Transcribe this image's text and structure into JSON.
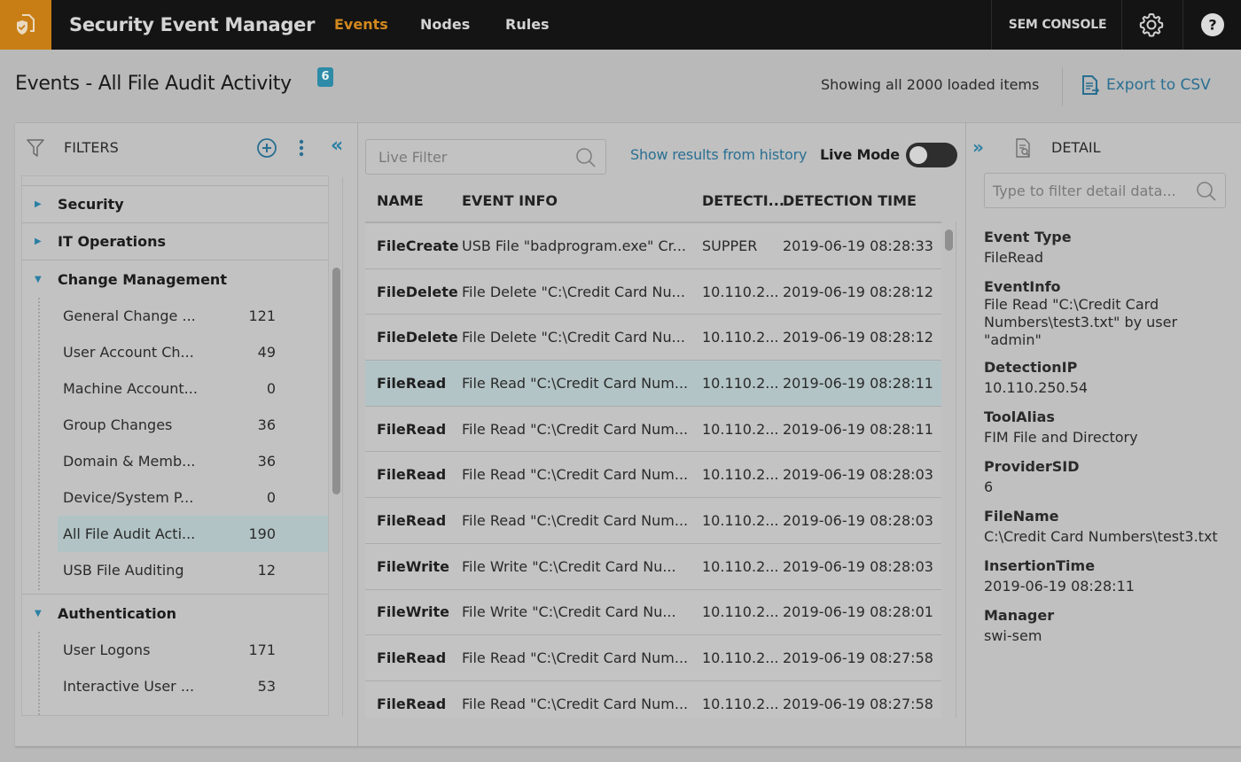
{
  "app": {
    "title": "Security Event Manager",
    "brand_color": "#c97e15",
    "nav": [
      {
        "label": "Events",
        "active": true
      },
      {
        "label": "Nodes",
        "active": false
      },
      {
        "label": "Rules",
        "active": false
      }
    ],
    "console_label": "SEM CONSOLE",
    "icons": {
      "logo": "shield-document-icon",
      "settings": "gear-icon",
      "help": "question-circle-icon"
    }
  },
  "page": {
    "title": "Events - All File Audit Activity",
    "badge": "6",
    "showing": "Showing all 2000 loaded items",
    "export_label": "Export to CSV"
  },
  "filters": {
    "label": "FILTERS",
    "groups": [
      {
        "label": "Security",
        "expanded": false,
        "children": []
      },
      {
        "label": "IT Operations",
        "expanded": false,
        "children": []
      },
      {
        "label": "Change Management",
        "expanded": true,
        "children": [
          {
            "label": "General Change ...",
            "count": "121",
            "selected": false
          },
          {
            "label": "User Account Ch...",
            "count": "49",
            "selected": false
          },
          {
            "label": "Machine Account...",
            "count": "0",
            "selected": false
          },
          {
            "label": "Group Changes",
            "count": "36",
            "selected": false
          },
          {
            "label": "Domain & Memb...",
            "count": "36",
            "selected": false
          },
          {
            "label": "Device/System P...",
            "count": "0",
            "selected": false
          },
          {
            "label": "All File Audit Acti...",
            "count": "190",
            "selected": true
          },
          {
            "label": "USB File Auditing",
            "count": "12",
            "selected": false
          }
        ]
      },
      {
        "label": "Authentication",
        "expanded": true,
        "children": [
          {
            "label": "User Logons",
            "count": "171",
            "selected": false
          },
          {
            "label": "Interactive User ...",
            "count": "53",
            "selected": false
          }
        ]
      }
    ]
  },
  "events": {
    "live_filter_placeholder": "Live Filter",
    "history_link": "Show results from history",
    "live_mode_label": "Live Mode",
    "live_mode_on": false,
    "columns": [
      "NAME",
      "EVENT INFO",
      "DETECTI...",
      "DETECTION TIME"
    ],
    "rows": [
      {
        "name": "FileCreate",
        "info": "USB File \"badprogram.exe\" Cr...",
        "ip": "SUPPER",
        "time": "2019-06-19 08:28:33",
        "selected": false
      },
      {
        "name": "FileDelete",
        "info": "File Delete \"C:\\Credit Card Nu...",
        "ip": "10.110.2...",
        "time": "2019-06-19 08:28:12",
        "selected": false
      },
      {
        "name": "FileDelete",
        "info": "File Delete \"C:\\Credit Card Nu...",
        "ip": "10.110.2...",
        "time": "2019-06-19 08:28:12",
        "selected": false
      },
      {
        "name": "FileRead",
        "info": "File Read \"C:\\Credit Card Num...",
        "ip": "10.110.2...",
        "time": "2019-06-19 08:28:11",
        "selected": true
      },
      {
        "name": "FileRead",
        "info": "File Read \"C:\\Credit Card Num...",
        "ip": "10.110.2...",
        "time": "2019-06-19 08:28:11",
        "selected": false
      },
      {
        "name": "FileRead",
        "info": "File Read \"C:\\Credit Card Num...",
        "ip": "10.110.2...",
        "time": "2019-06-19 08:28:03",
        "selected": false
      },
      {
        "name": "FileRead",
        "info": "File Read \"C:\\Credit Card Num...",
        "ip": "10.110.2...",
        "time": "2019-06-19 08:28:03",
        "selected": false
      },
      {
        "name": "FileWrite",
        "info": "File Write \"C:\\Credit Card Nu...",
        "ip": "10.110.2...",
        "time": "2019-06-19 08:28:03",
        "selected": false
      },
      {
        "name": "FileWrite",
        "info": "File Write \"C:\\Credit Card Nu...",
        "ip": "10.110.2...",
        "time": "2019-06-19 08:28:01",
        "selected": false
      },
      {
        "name": "FileRead",
        "info": "File Read \"C:\\Credit Card Num...",
        "ip": "10.110.2...",
        "time": "2019-06-19 08:27:58",
        "selected": false
      },
      {
        "name": "FileRead",
        "info": "File Read \"C:\\Credit Card Num...",
        "ip": "10.110.2...",
        "time": "2019-06-19 08:27:58",
        "selected": false
      }
    ]
  },
  "detail": {
    "title": "DETAIL",
    "filter_placeholder": "Type to filter detail data...",
    "fields": [
      {
        "key": "Event Type",
        "value": "FileRead"
      },
      {
        "key": "EventInfo",
        "value": "File Read \"C:\\Credit Card\nNumbers\\test3.txt\" by user \"admin\""
      },
      {
        "key": "DetectionIP",
        "value": "10.110.250.54"
      },
      {
        "key": "ToolAlias",
        "value": "FIM File and Directory"
      },
      {
        "key": "ProviderSID",
        "value": "6"
      },
      {
        "key": "FileName",
        "value": "C:\\Credit Card Numbers\\test3.txt"
      },
      {
        "key": "InsertionTime",
        "value": "2019-06-19 08:28:11"
      },
      {
        "key": "Manager",
        "value": "swi-sem"
      }
    ]
  }
}
